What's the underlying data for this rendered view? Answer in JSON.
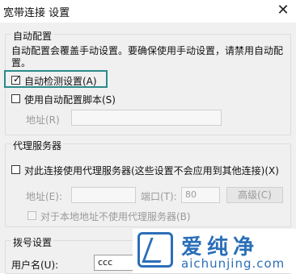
{
  "window": {
    "title": "宽带连接 设置",
    "close_glyph": "✕"
  },
  "auto_config": {
    "group_label": "自动配置",
    "note": "自动配置会覆盖手动设置。要确保使用手动设置，请禁用自动配置。",
    "auto_detect": {
      "label": "自动检测设置(A)",
      "checked": true
    },
    "use_script": {
      "label": "使用自动配置脚本(S)",
      "checked": false
    },
    "address_label": "地址(R)",
    "address_value": ""
  },
  "proxy": {
    "group_label": "代理服务器",
    "use_proxy": {
      "label": "对此连接使用代理服务器(这些设置不会应用到其他连接)(X)",
      "checked": false
    },
    "address_label": "地址(E):",
    "address_value": "",
    "port_label": "端口(T):",
    "port_value": "80",
    "advanced_button": "高级(C)",
    "bypass_local": {
      "label": "对于本地地址不使用代理服务器(B)",
      "checked": false
    }
  },
  "dialup": {
    "group_label": "拨号设置",
    "username_label": "用户名(U):",
    "username_value": "ccc"
  },
  "watermark": {
    "title": "爱纯净",
    "subtitle": "aichunjing.com",
    "color": "#2b6fb8"
  }
}
